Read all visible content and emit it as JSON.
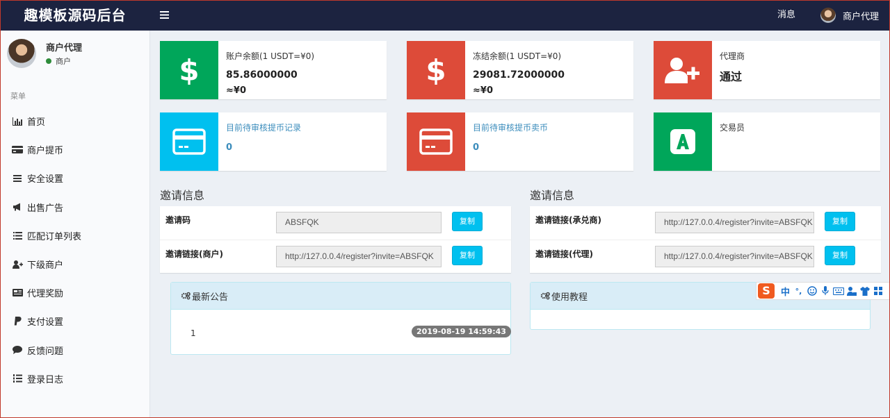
{
  "header": {
    "brand": "趣模板源码后台",
    "menu_toggle_icon": "hamburger-icon",
    "messages_label": "消息",
    "user_name": "商户代理"
  },
  "sidebar": {
    "user_name": "商户代理",
    "user_role": "商户",
    "menu_header": "菜单",
    "items": [
      {
        "label": "首页",
        "icon": "bar-chart-icon"
      },
      {
        "label": "商户提币",
        "icon": "credit-card-icon"
      },
      {
        "label": "安全设置",
        "icon": "list-icon"
      },
      {
        "label": "出售广告",
        "icon": "bullhorn-icon"
      },
      {
        "label": "匹配订单列表",
        "icon": "list-icon"
      },
      {
        "label": "下级商户",
        "icon": "user-plus-icon"
      },
      {
        "label": "代理奖励",
        "icon": "newspaper-icon"
      },
      {
        "label": "支付设置",
        "icon": "paypal-icon"
      },
      {
        "label": "反馈问题",
        "icon": "comment-icon"
      },
      {
        "label": "登录日志",
        "icon": "list-ol-icon"
      }
    ]
  },
  "boxes": {
    "balance": {
      "title": "账户余额(1 USDT=¥0)",
      "value": "85.86000000",
      "cny": "≈¥0",
      "color": "#00a65a"
    },
    "frozen": {
      "title": "冻结余额(1 USDT=¥0)",
      "value": "29081.72000000",
      "cny": "≈¥0",
      "color": "#dd4b39"
    },
    "agent": {
      "title": "代理商",
      "value": "通过",
      "color": "#dd4b39"
    },
    "pending_records": {
      "title": "目前待审核提币记录",
      "value": "0",
      "color": "#00c0ef"
    },
    "pending_sell": {
      "title": "目前待审核提币卖币",
      "value": "0",
      "color": "#dd4b39"
    },
    "trader": {
      "title": "交易员",
      "color": "#00a65a"
    }
  },
  "invite_left": {
    "title": "邀请信息",
    "rows": [
      {
        "label": "邀请码",
        "value": "ABSFQK",
        "button": "复制"
      },
      {
        "label": "邀请链接(商户)",
        "value": "http://127.0.0.4/register?invite=ABSFQK",
        "button": "复制"
      }
    ]
  },
  "invite_right": {
    "title": "邀请信息",
    "rows": [
      {
        "label": "邀请链接(承兑商)",
        "value": "http://127.0.0.4/register?invite=ABSFQK",
        "button": "复制"
      },
      {
        "label": "邀请链接(代理)",
        "value": "http://127.0.0.4/register?invite=ABSFQK",
        "button": "复制"
      }
    ]
  },
  "announcements": {
    "title": "最新公告",
    "items": [
      {
        "text": "1",
        "time": "2019-08-19 14:59:43"
      }
    ]
  },
  "tutorial": {
    "title": "使用教程"
  },
  "ime": {
    "logo": "S",
    "lang": "中",
    "punct": "°,"
  }
}
